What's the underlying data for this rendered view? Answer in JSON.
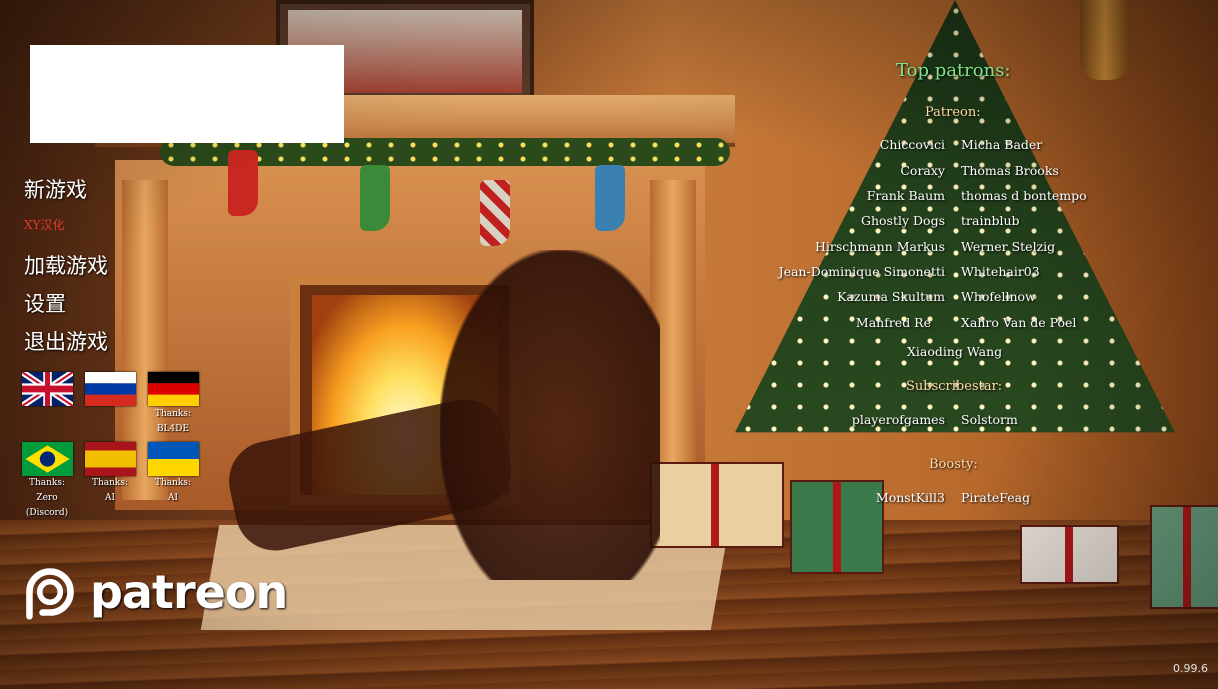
{
  "menu": {
    "new_game": "新游戏",
    "credit": "XY汉化",
    "load_game": "加载游戏",
    "settings": "设置",
    "quit": "退出游戏"
  },
  "languages": [
    {
      "name": "English",
      "thanks": ""
    },
    {
      "name": "Russian",
      "thanks": ""
    },
    {
      "name": "German",
      "thanks": [
        "Thanks:",
        "BL4DE"
      ]
    },
    {
      "name": "Portuguese (Brazil)",
      "thanks": [
        "Thanks:",
        "Zero",
        "(Discord)"
      ]
    },
    {
      "name": "Spanish",
      "thanks": [
        "Thanks:",
        "AI"
      ]
    },
    {
      "name": "Ukrainian",
      "thanks": [
        "Thanks:",
        "AI"
      ]
    }
  ],
  "patreon_logo_text": "patreon",
  "patrons": {
    "title": "Top patrons:",
    "patreon_label": "Patreon:",
    "patreon_left": [
      "Chiccovici",
      "Coraxy",
      "Frank Baum",
      "Ghostly Dogs",
      "Hirschmann Markus",
      "Jean-Dominique Simonetti",
      "Kazuma Skultum",
      "Manfred Re"
    ],
    "patreon_right": [
      "Micha Bader",
      "Thomas Brooks",
      "thomas d bontempo",
      "trainblub",
      "Werner Stelzig",
      "Whitehair03",
      "Whofellnow",
      "Xahro Van de Poel"
    ],
    "patreon_center": "Xiaoding Wang",
    "subscribestar_label": "Subscribestar:",
    "subscribestar_left": "playerofgames",
    "subscribestar_right": "Solstorm",
    "boosty_label": "Boosty:",
    "boosty_left": "MonstKill3",
    "boosty_right": "PirateFeag"
  },
  "version": "0.99.6",
  "colors": {
    "menu_text": "#ffffff",
    "credit_text": "#e23b2a",
    "patrons_title": "#7fe38a",
    "section_label": "#ffdba6"
  }
}
